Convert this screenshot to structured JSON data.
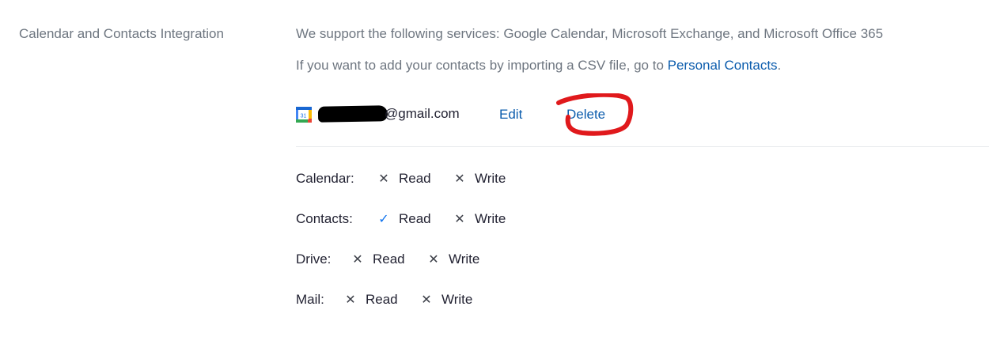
{
  "section": {
    "label": "Calendar and Contacts Integration"
  },
  "info": {
    "services_text": "We support the following services: Google Calendar, Microsoft Exchange, and Microsoft Office 365",
    "csv_prefix": "If you want to add your contacts by importing a CSV file, go to ",
    "csv_link": "Personal Contacts",
    "csv_suffix": "."
  },
  "account": {
    "icon": "google-calendar-icon",
    "icon_day": "31",
    "email_visible": "@gmail.com",
    "edit_label": "Edit",
    "delete_label": "Delete"
  },
  "permissions": {
    "calendar": {
      "label": "Calendar:",
      "read": {
        "label": "Read",
        "granted": false
      },
      "write": {
        "label": "Write",
        "granted": false
      }
    },
    "contacts": {
      "label": "Contacts:",
      "read": {
        "label": "Read",
        "granted": true
      },
      "write": {
        "label": "Write",
        "granted": false
      }
    },
    "drive": {
      "label": "Drive:",
      "read": {
        "label": "Read",
        "granted": false
      },
      "write": {
        "label": "Write",
        "granted": false
      }
    },
    "mail": {
      "label": "Mail:",
      "read": {
        "label": "Read",
        "granted": false
      },
      "write": {
        "label": "Write",
        "granted": false
      }
    }
  },
  "symbols": {
    "granted": "✓",
    "denied": "✕"
  },
  "colors": {
    "link": "#0b5cad",
    "check": "#0e72ed",
    "annotation": "#e0191c",
    "muted_text": "#6e7680"
  }
}
